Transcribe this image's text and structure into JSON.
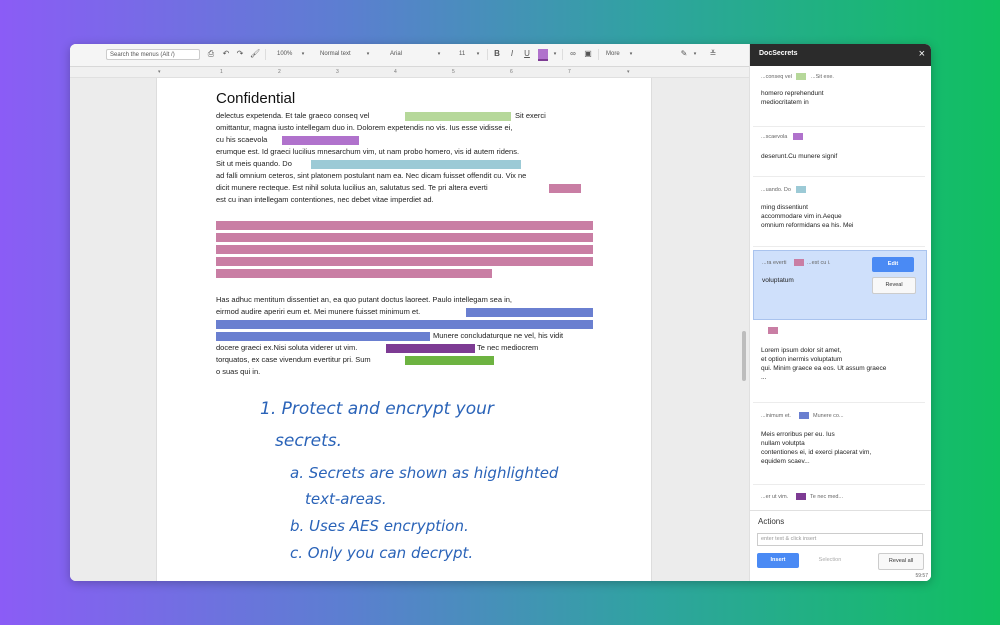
{
  "toolbar": {
    "search_placeholder": "Search the menus (Alt /)",
    "zoom": "100%",
    "style": "Normal text",
    "font": "Arial",
    "size": "11",
    "bold": "B",
    "italic": "I",
    "underline": "U",
    "more": "More",
    "collapse": "≚"
  },
  "ruler": {
    "marks": [
      "1",
      "2",
      "3",
      "4",
      "5",
      "6",
      "7"
    ]
  },
  "doc": {
    "title": "Confidential",
    "lines": [
      "delectus expetenda. Et tale graeco conseq vel",
      "Sit exerci",
      "omittantur, magna iusto intellegam duo in. Dolorem expetendis no vis. Ius esse vidisse ei,",
      "cu his scaevola",
      "erumque est. Id graeci lucilius mnesarchum vim, ut nam probo homero, vis id autem ridens.",
      "Sit ut meis quando. Do",
      "ad falli omnium ceteros, sint platonem postulant nam ea. Nec dicam fuisset offendit cu. Vix ne",
      "dicit munere recteque. Est nihil soluta lucilius an, salutatus sed. Te pri altera everti",
      "est cu inan intellegam contentiones, nec debet vitae imperdiet ad.",
      "Has adhuc mentitum dissentiet an, ea quo putant doctus laoreet. Paulo intellegam sea in,",
      "eirmod audire aperiri eum et. Mei munere fuisset minimum et.",
      "Munere concludaturque ne vel, his vidit",
      "docere graeci ex.Nisi soluta viderer ut vim.",
      "Te nec mediocrem",
      "torquatos, ex case vivendum evertitur pri. Sum",
      "o suas qui in."
    ],
    "handwriting": [
      "1. Protect and encrypt your",
      "secrets.",
      "a. Secrets are shown as highlighted",
      "text-areas.",
      "b. Uses AES encryption.",
      "c. Only you can decrypt."
    ]
  },
  "colors": {
    "green": "#b6d89a",
    "purple": "#b072cc",
    "teal": "#9ccad6",
    "pink": "#c97ea4",
    "blue": "#6a7fd0",
    "dark_purple": "#7d3b93",
    "bright_green": "#6db341",
    "panel_selected": "#cfe0fb",
    "primary": "#4a8af4"
  },
  "panel": {
    "title": "DocSecrets",
    "close": "×",
    "cards": [
      {
        "meta_left": "...conseq vel",
        "meta_right": "...Sit exe.",
        "text": "homero reprehendunt\nmediocritatem in"
      },
      {
        "meta_left": "...scaevola",
        "meta_right": "",
        "text": "deserunt.Cu munere signif"
      },
      {
        "meta_left": "...uando. Do",
        "meta_right": "",
        "text": "ming dissentiunt\naccommodare vim in.Aeque\nomnium reformidans ea his. Mei"
      },
      {
        "meta_left": "...ra everti",
        "meta_right": "...est cu i.",
        "text": "voluptatum",
        "edit": "Edit",
        "reveal": "Reveal"
      },
      {
        "meta_left": "",
        "meta_right": "",
        "text": "Lorem ipsum dolor sit amet,\net option inermis voluptatum\nqui. Minim graece ea eos. Ut assum graece\n..."
      },
      {
        "meta_left": "...inimum et.",
        "meta_right": "Munere co...",
        "text": "Meis erroribus per eu. Ius\nnullam volutpta\ncontentiones ei, id exerci placerat vim,\nequidem scaev..."
      },
      {
        "meta_left": "...er ut vim.",
        "meta_right": "Te nec med...",
        "text": ""
      }
    ],
    "actions": {
      "label": "Actions",
      "placeholder": "enter text & click insert",
      "insert": "Insert",
      "selection": "Selection",
      "reveal_all": "Reveal all",
      "count": "59:57"
    }
  }
}
